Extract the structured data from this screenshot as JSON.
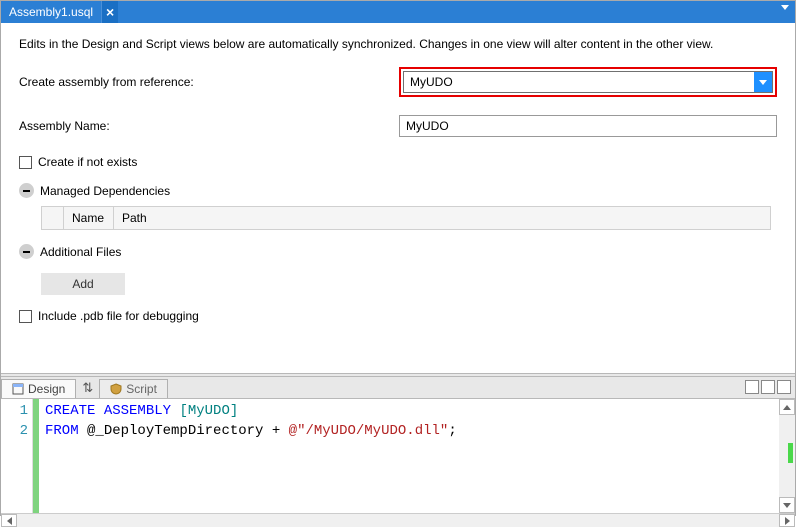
{
  "tab": {
    "filename": "Assembly1.usql",
    "close": "×"
  },
  "hint": "Edits in the Design and Script views below are automatically synchronized. Changes in one view will alter content in the other view.",
  "form": {
    "reference_label": "Create assembly from reference:",
    "reference_value": "MyUDO",
    "name_label": "Assembly Name:",
    "name_value": "MyUDO",
    "create_if_not_exists": "Create if not exists",
    "managed_deps": "Managed Dependencies",
    "additional_files": "Additional Files",
    "dep_cols": {
      "name": "Name",
      "path": "Path"
    },
    "add": "Add",
    "include_pdb": "Include .pdb file for debugging"
  },
  "bottom_tabs": {
    "design": "Design",
    "swap": "⇅",
    "script": "Script"
  },
  "code": {
    "lines": [
      "1",
      "2"
    ],
    "l1_kw1": "CREATE",
    "l1_kw2": "ASSEMBLY",
    "l1_obj": "[MyUDO]",
    "l2_kw": "FROM",
    "l2_var": "@_DeployTempDirectory",
    "l2_plus": " + ",
    "l2_str": "@\"/MyUDO/MyUDO.dll\"",
    "l2_semi": ";"
  }
}
